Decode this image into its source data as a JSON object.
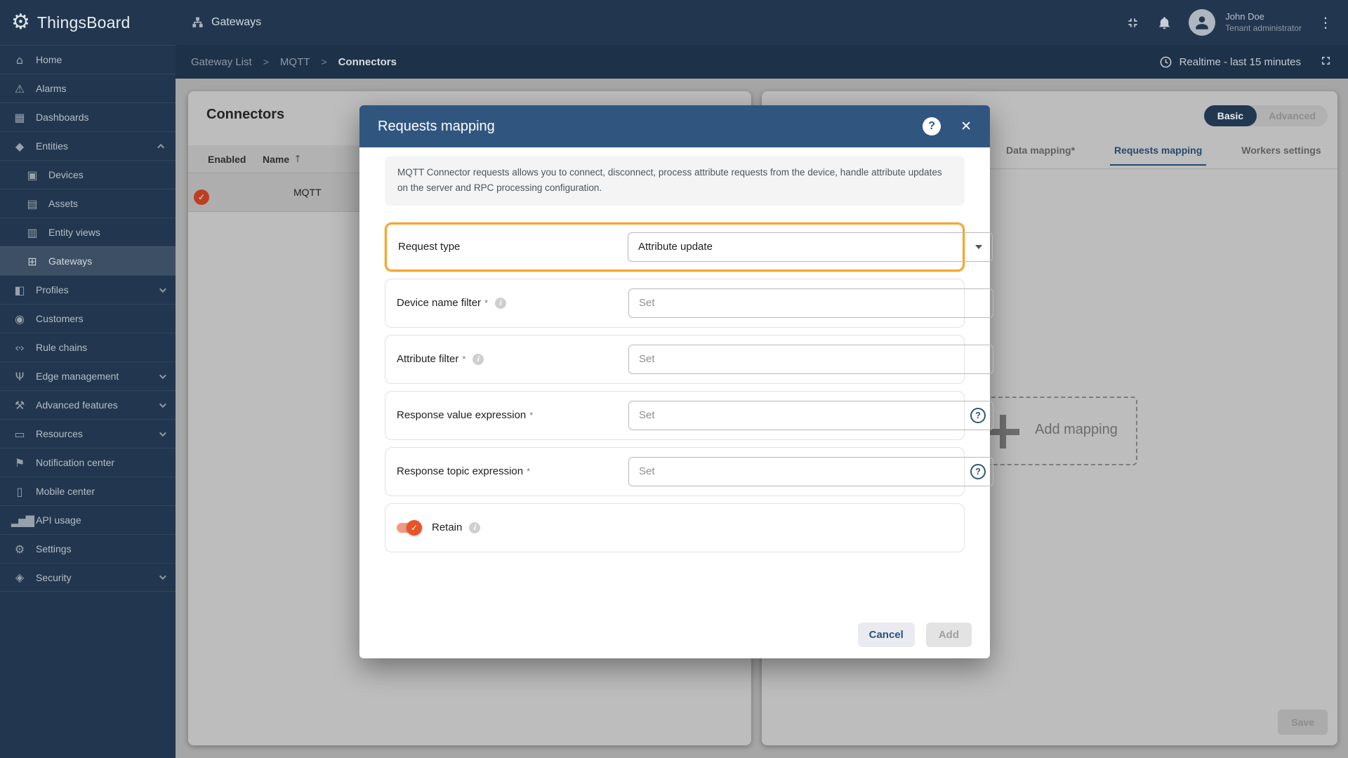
{
  "colors": {
    "primary": "#305680",
    "highlight_border": "#f7a62e",
    "toggle_on": "#e85427",
    "sidebar_bg": "#22374f"
  },
  "icons": {
    "check": "✓",
    "kebab": "⋮",
    "sort_asc": "↑",
    "sep": ">",
    "help": "?",
    "close": "✕",
    "info": "i"
  },
  "brand": {
    "name": "ThingsBoard",
    "logo_glyph": "⚙"
  },
  "topbar": {
    "title": "Gateways",
    "user_name": "John Doe",
    "user_role": "Tenant administrator"
  },
  "breadcrumb": {
    "items": [
      "Gateway List",
      "MQTT",
      "Connectors"
    ]
  },
  "timebar": {
    "range_label": "Realtime - last 15 minutes"
  },
  "sidebar": {
    "items": [
      {
        "label": "Home",
        "icon": "⌂"
      },
      {
        "label": "Alarms",
        "icon": "⚠"
      },
      {
        "label": "Dashboards",
        "icon": "▦"
      },
      {
        "label": "Entities",
        "icon": "◆"
      },
      {
        "label": "Devices",
        "icon": "▣"
      },
      {
        "label": "Assets",
        "icon": "▤"
      },
      {
        "label": "Entity views",
        "icon": "▥"
      },
      {
        "label": "Gateways",
        "icon": "⊞"
      },
      {
        "label": "Profiles",
        "icon": "◧"
      },
      {
        "label": "Customers",
        "icon": "◉"
      },
      {
        "label": "Rule chains",
        "icon": "‹·›"
      },
      {
        "label": "Edge management",
        "icon": "Ψ"
      },
      {
        "label": "Advanced features",
        "icon": "⚒"
      },
      {
        "label": "Resources",
        "icon": "▭"
      },
      {
        "label": "Notification center",
        "icon": "⚑"
      },
      {
        "label": "Mobile center",
        "icon": "▯"
      },
      {
        "label": "API usage",
        "icon": "▂▅▇"
      },
      {
        "label": "Settings",
        "icon": "⚙"
      },
      {
        "label": "Security",
        "icon": "◈"
      }
    ]
  },
  "connectors_panel": {
    "title": "Connectors",
    "col_enabled": "Enabled",
    "col_name": "Name",
    "rows": [
      {
        "name": "MQTT",
        "enabled": "on"
      }
    ]
  },
  "detail_panel": {
    "mode_basic": "Basic",
    "mode_advanced": "Advanced",
    "tabs": [
      "Data mapping*",
      "Requests mapping",
      "Workers settings"
    ],
    "active_tab": "Requests mapping",
    "add_mapping": "Add mapping",
    "save": "Save"
  },
  "modal": {
    "title": "Requests mapping",
    "info": "MQTT Connector requests allows you to connect, disconnect, process attribute requests from the device, handle attribute updates on the server and RPC processing configuration.",
    "request_type": {
      "label": "Request type",
      "value": "Attribute update"
    },
    "device_name_filter": {
      "label": "Device name filter",
      "required": "*",
      "placeholder": "Set"
    },
    "attribute_filter": {
      "label": "Attribute filter",
      "required": "*",
      "placeholder": "Set"
    },
    "response_value_expression": {
      "label": "Response value expression",
      "required": "*",
      "placeholder": "Set"
    },
    "response_topic_expression": {
      "label": "Response topic expression",
      "required": "*",
      "placeholder": "Set"
    },
    "retain": {
      "label": "Retain",
      "state": "on"
    },
    "cancel": "Cancel",
    "add": "Add"
  }
}
